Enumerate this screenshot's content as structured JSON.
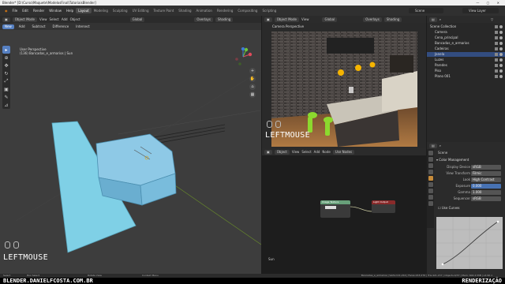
{
  "window": {
    "title": "Blender* [D:\\Curso\\Maquete\\ModelosFinal\\TutoriaisBlender]",
    "controls": "—  ▢  ✕"
  },
  "menu": {
    "items": [
      "File",
      "Edit",
      "Render",
      "Window",
      "Help"
    ],
    "workspaces": [
      "Layout",
      "Modeling",
      "Sculpting",
      "UV Editing",
      "Texture Paint",
      "Shading",
      "Animation",
      "Rendering",
      "Compositing",
      "Scripting"
    ],
    "active_workspace": "Layout",
    "scene": "Scene",
    "view_layer": "View Layer"
  },
  "viewport": {
    "header": {
      "mode": "Object Mode",
      "menus": [
        "View",
        "Select",
        "Add",
        "Object"
      ],
      "transform": "Global",
      "overlays": "Overlays",
      "shading": "Shading"
    },
    "header2": {
      "pills": [
        "New",
        "Add",
        "Subtract",
        "Difference",
        "Intersect"
      ],
      "active": "New"
    },
    "info": {
      "line1": "User Perspective",
      "line2": "(136) Bancadas_e_armarios | Sun"
    },
    "gizmo": {
      "x": "X",
      "y": "Y",
      "z": "Z"
    },
    "keycast": "LEFTMOUSE",
    "tools": [
      "cursor",
      "move",
      "rotate",
      "scale",
      "transform",
      "annotate",
      "measure"
    ],
    "nav_tools": [
      "zoom",
      "pan",
      "camera",
      "ortho"
    ]
  },
  "render_view": {
    "header": {
      "mode": "Object Mode",
      "menus": [
        "View"
      ],
      "transform": "Global",
      "overlays": "Overlays",
      "shading": "Shading"
    },
    "label": "Camera Perspective",
    "keycast": "LEFTMOUSE"
  },
  "node_editor": {
    "header": {
      "menus": [
        "Object",
        "View",
        "Select",
        "Add",
        "Node"
      ],
      "use_nodes": "Use Nodes"
    },
    "nodes": [
      {
        "title": "Image Texture",
        "color": "#68a07a"
      },
      {
        "title": "Light Output",
        "color": "#8a2a2a"
      }
    ],
    "footer": "Sun"
  },
  "outliner": {
    "header": "Scene Collection",
    "rows": [
      {
        "label": "Scene Collection",
        "selected": false
      },
      {
        "label": "Camera",
        "selected": false
      },
      {
        "label": "Cena_principal",
        "selected": false
      },
      {
        "label": "Bancadas_e_armarios",
        "selected": false
      },
      {
        "label": "Cadeiras",
        "selected": false
      },
      {
        "label": "Janela",
        "selected": true
      },
      {
        "label": "Luzes",
        "selected": false
      },
      {
        "label": "Paredes",
        "selected": false
      },
      {
        "label": "Piso",
        "selected": false
      },
      {
        "label": "Plano 001",
        "selected": false
      }
    ]
  },
  "properties": {
    "scene_label": "Scene",
    "section": "Color Management",
    "rows": [
      {
        "label": "Display Device",
        "value": "sRGB",
        "blue": false
      },
      {
        "label": "View Transform",
        "value": "Filmic",
        "blue": false
      },
      {
        "label": "Look",
        "value": "High Contrast",
        "blue": false
      },
      {
        "label": "Exposure",
        "value": "0.000",
        "blue": true
      },
      {
        "label": "Gamma",
        "value": "1.000",
        "blue": false
      },
      {
        "label": "Sequencer",
        "value": "sRGB",
        "blue": false
      }
    ],
    "curves_label": "Use Curves"
  },
  "status": {
    "left_items": [
      "Select",
      "Box Select",
      "Rotate View",
      "Context Menu"
    ],
    "stats": "Bancadas_e_armarios | Verts:111,214 | Faces:213,276 | Tris:421,157 | Objects:0/37 | Mem: 602.4 MiB | v2.90.1"
  },
  "watermark": {
    "left": "BLENDER.DANIELFCOSTA.COM.BR",
    "right": "RENDERIZAÇÃO"
  },
  "colors": {
    "accent": "#5680c2",
    "selection": "#334d80",
    "viewport_bg": "#3d3d3d",
    "model_blue": "#7fd0e6"
  }
}
